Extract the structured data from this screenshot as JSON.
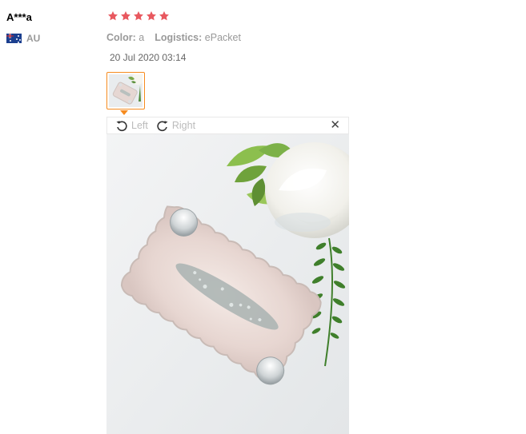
{
  "review": {
    "user": {
      "name": "A***a",
      "country": "AU",
      "flag_icon": "australia-flag-icon"
    },
    "rating": 5,
    "rating_color": "#e8585f",
    "attributes": {
      "color_label": "Color:",
      "color_value": "a",
      "logistics_label": "Logistics:",
      "logistics_value": "ePacket"
    },
    "date": "20 Jul 2020 03:14",
    "thumbnail_border_color": "#f68b1f"
  },
  "image_viewer": {
    "rotate_left_label": "Left",
    "rotate_right_label": "Right",
    "close_icon": "close-icon"
  }
}
